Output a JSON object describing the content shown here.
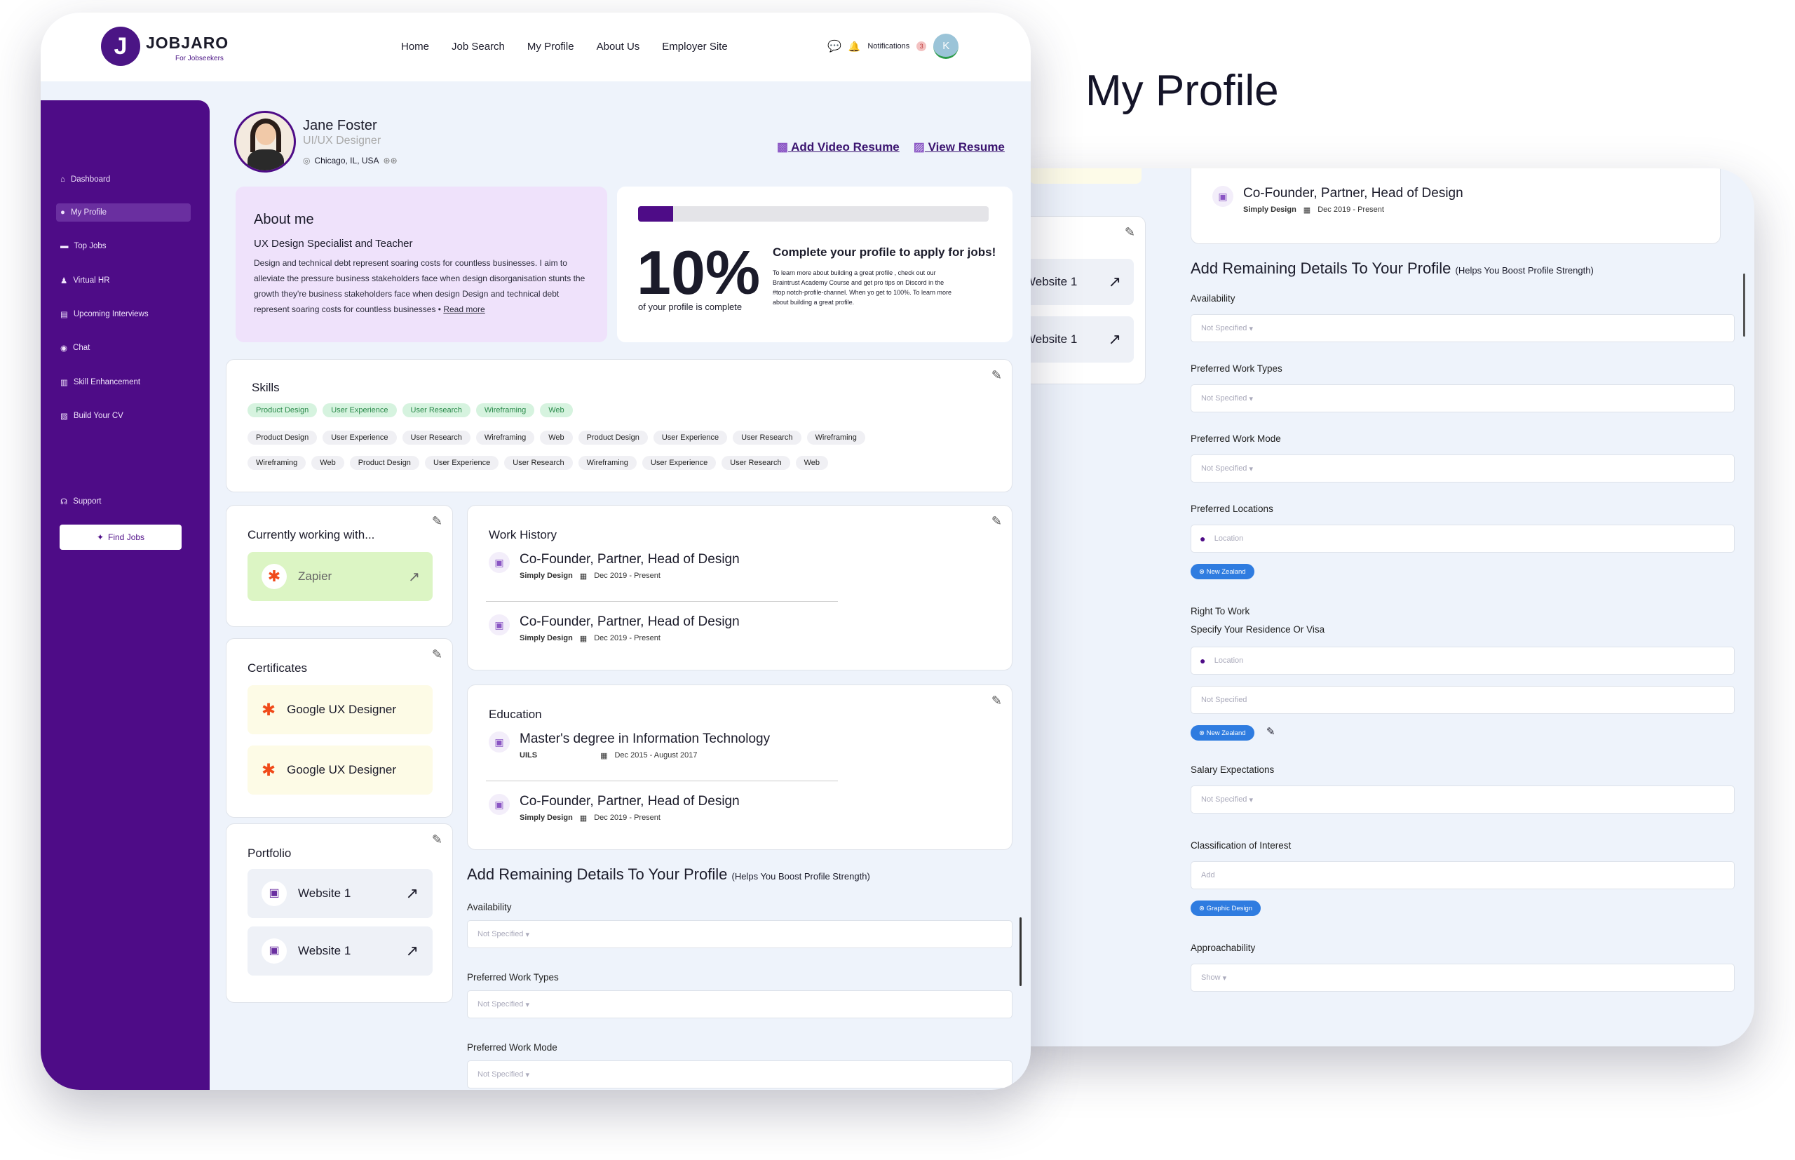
{
  "title": "My Profile",
  "app": {
    "brand": "JOBJARO",
    "brand_sub": "For Jobseekers",
    "logo_letter": "J"
  },
  "nav": [
    "Home",
    "Job Search",
    "My Profile",
    "About Us",
    "Employer Site"
  ],
  "header": {
    "notifications_label": "Notifications",
    "notifications_count": "3",
    "avatar_letter": "K"
  },
  "sidebar": {
    "items": [
      "Dashboard",
      "My Profile",
      "Top Jobs",
      "Virtual HR",
      "Upcoming Interviews",
      "Chat",
      "Skill Enhancement",
      "Build Your CV"
    ],
    "support": "Support",
    "find_jobs": "Find Jobs"
  },
  "profile": {
    "name": "Jane Foster",
    "role": "UI/UX Designer",
    "location": "Chicago, IL, USA",
    "add_video": "Add Video Resume",
    "view_resume": "View Resume"
  },
  "about": {
    "heading": "About me",
    "subtitle": "UX Design Specialist and Teacher",
    "body": "Design and technical debt represent soaring costs for countless businesses. I aim to alleviate the pressure business stakeholders face when design disorganisation stunts the growth they're business stakeholders face when design Design and technical debt represent soaring costs for countless businesses",
    "read_more": "Read more"
  },
  "completion": {
    "percent": "10%",
    "progress": 0.1,
    "caption": "of your profile is complete",
    "heading": "Complete your profile to apply for jobs!",
    "body": "To learn more about building a great profile , check out our Braintrust Academy Course and get pro tips on Discord in the #top notch-profile-channel. When yo get to 100%. To learn more about building a great profile."
  },
  "skills": {
    "heading": "Skills",
    "featured": [
      "Product Design",
      "User Experience",
      "User Research",
      "Wireframing",
      "Web"
    ],
    "row2": [
      "Product Design",
      "User Experience",
      "User Research",
      "Wireframing",
      "Web",
      "Product Design",
      "User Experience",
      "User Research",
      "Wireframing"
    ],
    "row3": [
      "Wireframing",
      "Web",
      "Product Design",
      "User Experience",
      "User Research",
      "Wireframing",
      "User Experience",
      "User Research",
      "Web"
    ]
  },
  "current": {
    "heading": "Currently working with...",
    "company": "Zapier"
  },
  "certificates": {
    "heading": "Certificates",
    "items": [
      "Google UX Designer",
      "Google UX Designer"
    ]
  },
  "portfolio": {
    "heading": "Portfolio",
    "items": [
      "Website 1",
      "Website 1"
    ]
  },
  "work": {
    "heading": "Work History",
    "items": [
      {
        "title": "Co-Founder, Partner, Head of Design",
        "company": "Simply Design",
        "dates": "Dec 2019 - Present"
      },
      {
        "title": "Co-Founder, Partner, Head of Design",
        "company": "Simply Design",
        "dates": "Dec 2019 - Present"
      }
    ]
  },
  "education": {
    "heading": "Education",
    "items": [
      {
        "title": "Master's degree in Information Technology",
        "company": "UILS",
        "dates": "Dec 2015 - August 2017"
      },
      {
        "title": "Co-Founder, Partner, Head of Design",
        "company": "Simply Design",
        "dates": "Dec 2019 - Present"
      }
    ]
  },
  "remaining": {
    "heading": "Add Remaining Details To Your Profile",
    "sub": "(Helps You Boost Profile Strength)",
    "not_specified": "Not Specified",
    "location": "Location",
    "add": "Add",
    "show": "Show",
    "availability": "Availability",
    "work_types": "Preferred Work Types",
    "work_mode": "Preferred Work Mode",
    "locations": "Preferred Locations",
    "right_to_work": "Right To Work",
    "residence": "Specify Your Residence Or Visa",
    "salary": "Salary Expectations",
    "classification": "Classification of Interest",
    "approachability": "Approachability",
    "new_zealand": "New Zealand",
    "graphic_design": "Graphic Design"
  },
  "colors": {
    "primary": "#4e0c87",
    "accent": "#2f7ce0",
    "green": "#2b8a4b"
  }
}
